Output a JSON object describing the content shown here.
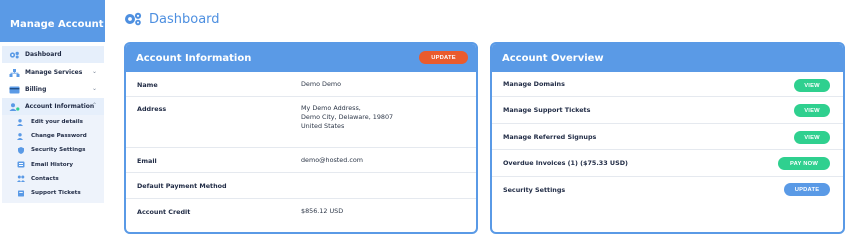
{
  "sidebar": {
    "title": "Manage Account",
    "items": [
      {
        "label": "Dashboard"
      },
      {
        "label": "Manage Services"
      },
      {
        "label": "Billing"
      },
      {
        "label": "Account Information"
      }
    ],
    "subitems": [
      {
        "label": "Edit your details"
      },
      {
        "label": "Change Password"
      },
      {
        "label": "Security Settings"
      },
      {
        "label": "Email History"
      },
      {
        "label": "Contacts"
      },
      {
        "label": "Support Tickets"
      }
    ]
  },
  "page": {
    "title": "Dashboard"
  },
  "account_info": {
    "title": "Account Information",
    "update_label": "UPDATE",
    "rows": [
      {
        "label": "Name",
        "value": "Demo Demo"
      },
      {
        "label": "Address",
        "lines": [
          "My Demo Address,",
          "Demo City, Delaware, 19807",
          "United States"
        ]
      },
      {
        "label": "Email",
        "value": "demo@hosted.com"
      },
      {
        "label": "Default Payment Method",
        "value": ""
      },
      {
        "label": "Account Credit",
        "value": "$856.12 USD"
      }
    ]
  },
  "account_overview": {
    "title": "Account Overview",
    "rows": [
      {
        "label": "Manage Domains",
        "action": "VIEW"
      },
      {
        "label": "Manage Support Tickets",
        "action": "VIEW"
      },
      {
        "label": "Manage Referred Signups",
        "action": "VIEW"
      },
      {
        "label": "Overdue Invoices (1) ($75.33 USD)",
        "action": "PAY NOW"
      },
      {
        "label": "Security Settings",
        "action": "UPDATE"
      }
    ]
  },
  "colors": {
    "brand_blue": "#5a9ae6",
    "title_blue": "#4d8fe0",
    "green": "#2fd08f",
    "orange": "#ea5b2d",
    "sidebar_highlight": "#e6effb"
  },
  "icons": {
    "dashboard": "cogs-icon",
    "services": "network-icon",
    "billing": "credit-card-icon",
    "account": "user-cog-icon",
    "edit": "user-edit-icon",
    "password": "user-lock-icon",
    "security": "shield-icon",
    "email": "email-history-icon",
    "contacts": "users-icon",
    "tickets": "ticket-icon"
  }
}
